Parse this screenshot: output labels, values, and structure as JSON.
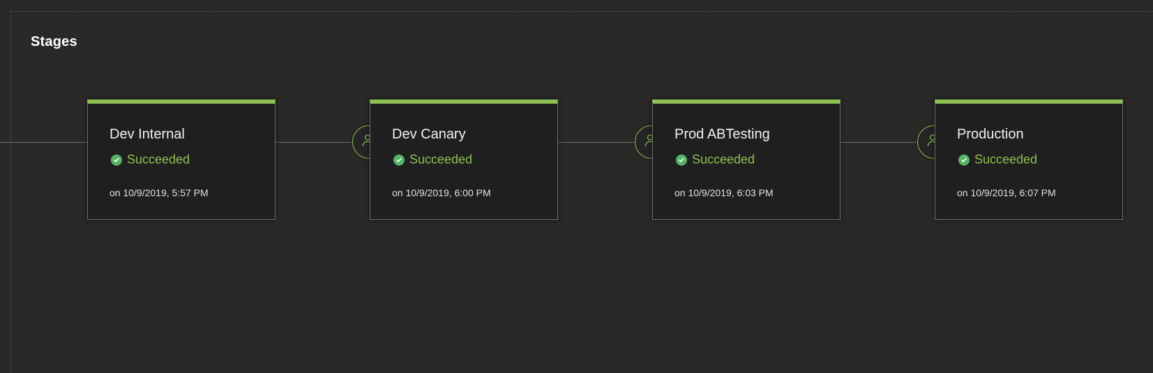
{
  "section": {
    "title": "Stages"
  },
  "colors": {
    "accent": "#8dc152",
    "status_icon": "#56b36a",
    "background": "#2a2928",
    "card": "#1f1f1f"
  },
  "stages": [
    {
      "name": "Dev Internal",
      "status": "Succeeded",
      "status_icon": "check-circle-icon",
      "date": "on 10/9/2019, 5:57 PM",
      "pre_approval": false
    },
    {
      "name": "Dev Canary",
      "status": "Succeeded",
      "status_icon": "check-circle-icon",
      "date": "on 10/9/2019, 6:00 PM",
      "pre_approval": true,
      "approval_icon": "user-approval-icon"
    },
    {
      "name": "Prod ABTesting",
      "status": "Succeeded",
      "status_icon": "check-circle-icon",
      "date": "on 10/9/2019, 6:03 PM",
      "pre_approval": true,
      "approval_icon": "user-approval-icon"
    },
    {
      "name": "Production",
      "status": "Succeeded",
      "status_icon": "check-circle-icon",
      "date": "on 10/9/2019, 6:07 PM",
      "pre_approval": true,
      "approval_icon": "user-approval-icon"
    }
  ]
}
